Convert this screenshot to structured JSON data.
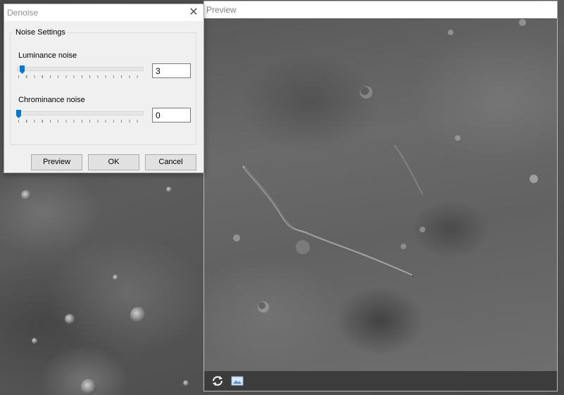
{
  "dialog": {
    "title": "Denoise",
    "group_label": "Noise Settings",
    "luminance": {
      "label": "Luminance noise",
      "value": "3",
      "slider_fraction": 0.03
    },
    "chrominance": {
      "label": "Chrominance noise",
      "value": "0",
      "slider_fraction": 0.0
    },
    "buttons": {
      "preview": "Preview",
      "ok": "OK",
      "cancel": "Cancel"
    },
    "close_icon": "close-icon"
  },
  "preview_window": {
    "title": "Preview",
    "toolbar": {
      "icons": [
        "refresh-icon",
        "image-icon"
      ]
    }
  },
  "colors": {
    "accent": "#0078d7",
    "toolbar_bg": "#3c3c3c",
    "dialog_bg": "#f0f0f0"
  }
}
